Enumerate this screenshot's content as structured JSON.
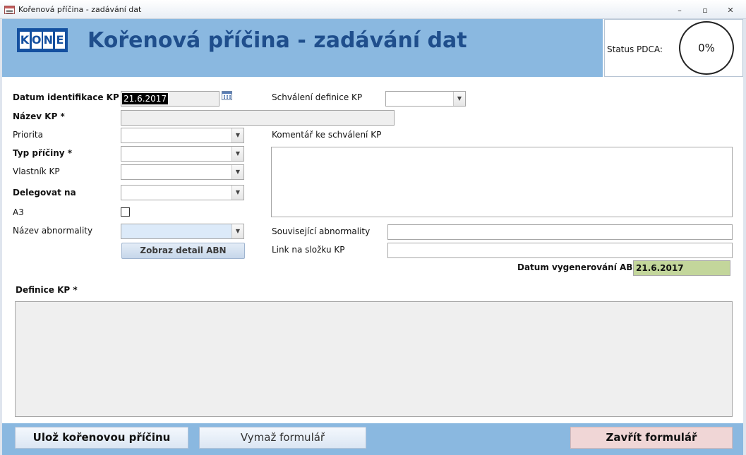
{
  "window": {
    "title": "Kořenová příčina - zadávání dat",
    "minimize": "–",
    "restore": "▫",
    "close": "✕"
  },
  "header": {
    "logo_letters": [
      "K",
      "O",
      "N",
      "E"
    ],
    "title": "Kořenová příčina - zadávání dat",
    "status_label": "Status PDCA:",
    "status_value": "0%"
  },
  "form": {
    "datum_identifikace": {
      "label": "Datum identifikace KP *",
      "value": "21.6.2017"
    },
    "nazev_kp": {
      "label": "Název KP *",
      "value": ""
    },
    "priorita": {
      "label": "Priorita",
      "value": ""
    },
    "typ_priciny": {
      "label": "Typ příčiny *",
      "value": ""
    },
    "vlastnik_kp": {
      "label": "Vlastník KP",
      "value": ""
    },
    "delegovat_na": {
      "label": "Delegovat na",
      "value": ""
    },
    "a3": {
      "label": "A3",
      "checked": false
    },
    "nazev_abnormality": {
      "label": "Název abnormality",
      "value": ""
    },
    "zobraz_detail_btn": "Zobraz detail ABN",
    "schvaleni_definice": {
      "label": "Schválení definice KP",
      "value": ""
    },
    "komentar": {
      "label": "Komentář ke schválení KP",
      "value": ""
    },
    "souvisejici_abnormality": {
      "label": "Související abnormality",
      "value": ""
    },
    "link_na_slozku": {
      "label": "Link na složku KP",
      "value": ""
    },
    "datum_vygenerovani": {
      "label": "Datum vygenerování ABN",
      "value": "21.6.2017"
    },
    "definice_kp": {
      "label": "Definice KP *",
      "value": ""
    }
  },
  "footer": {
    "save_label": "Ulož kořenovou příčinu",
    "clear_label": "Vymaž formulář",
    "close_label": "Zavřít formulář"
  },
  "colors": {
    "header_band": "#8ab8e0",
    "title_text": "#1f4e8c",
    "logo_blue": "#1450a0",
    "close_button": "#f0d6d6",
    "generated_date_field": "#c3d69b"
  }
}
